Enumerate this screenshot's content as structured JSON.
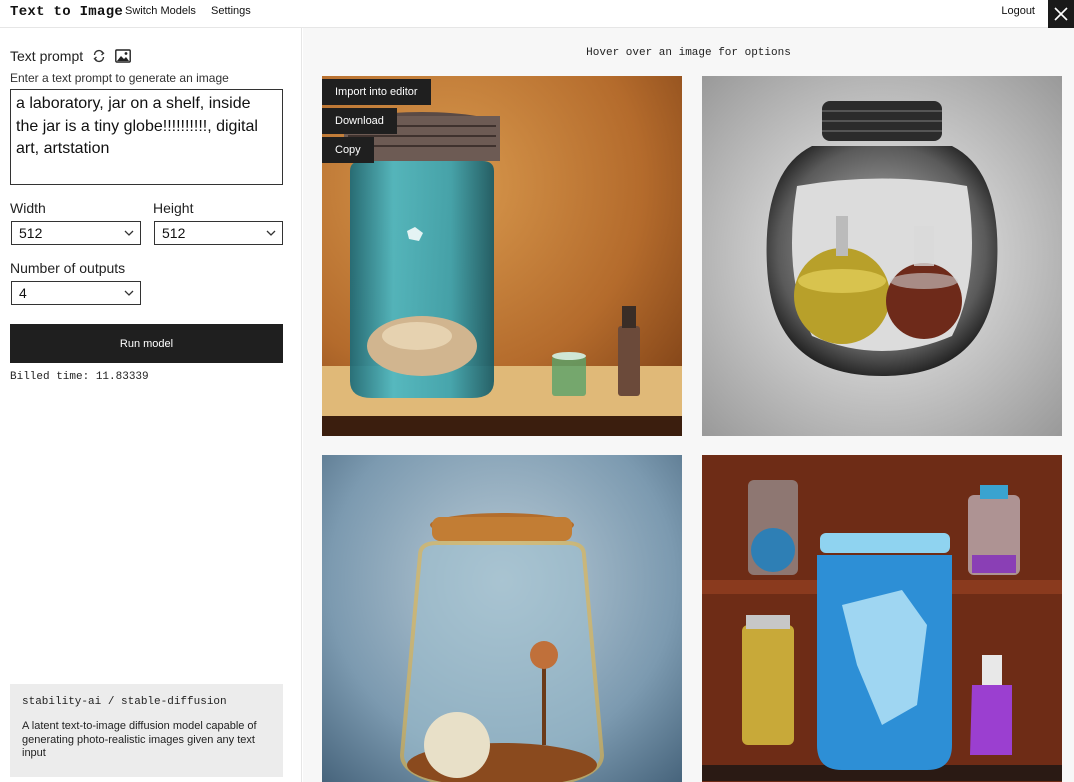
{
  "header": {
    "title": "Text to Image",
    "nav": {
      "switch_models": "Switch Models",
      "settings": "Settings"
    },
    "logout": "Logout"
  },
  "form": {
    "prompt_label": "Text prompt",
    "prompt_hint": "Enter a text prompt to generate an image",
    "prompt_value": "a laboratory, jar on a shelf, inside the jar is a tiny globe!!!!!!!!!!, digital art, artstation",
    "width_label": "Width",
    "width_value": "512",
    "height_label": "Height",
    "height_value": "512",
    "outputs_label": "Number of outputs",
    "outputs_value": "4",
    "run_label": "Run model",
    "billed_text": "Billed time: 11.83339"
  },
  "model": {
    "name": "stability-ai / stable-diffusion",
    "description": "A latent text-to-image diffusion model capable of generating photo-realistic images given any text input"
  },
  "results": {
    "hint": "Hover over an image for options",
    "actions": {
      "import": "Import into editor",
      "download": "Download",
      "copy": "Copy"
    }
  },
  "icons": {
    "refresh": "refresh-icon",
    "image": "image-icon",
    "close": "close-icon",
    "dropdown": "chevron-down-icon"
  },
  "colors": {
    "button_bg": "#1f1f1f",
    "panel_bg": "#ececec",
    "results_bg": "#f7f7f7"
  }
}
